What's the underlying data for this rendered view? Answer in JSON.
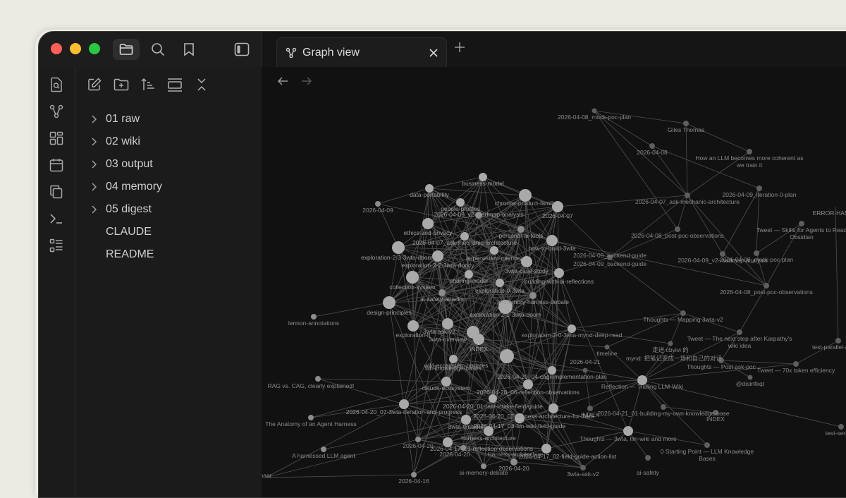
{
  "window": {
    "tabs": [
      {
        "label": "Graph view",
        "icon": "graph-icon"
      }
    ]
  },
  "titlebar": {
    "buttons": [
      "folder-icon",
      "search-icon",
      "bookmark-icon",
      "sidebar-toggle-icon"
    ]
  },
  "ribbon": {
    "icons": [
      "search-file-icon",
      "graph-icon",
      "dashboard-icon",
      "calendar-icon",
      "copy-icon",
      "terminal-icon",
      "list-icon"
    ]
  },
  "sidebar": {
    "tools": [
      "new-note-icon",
      "new-folder-icon",
      "sort-icon",
      "collapse-view-icon",
      "collapse-all-icon"
    ],
    "items": [
      {
        "label": "01 raw",
        "type": "folder"
      },
      {
        "label": "02 wiki",
        "type": "folder"
      },
      {
        "label": "03 output",
        "type": "folder"
      },
      {
        "label": "04 memory",
        "type": "folder"
      },
      {
        "label": "05 digest",
        "type": "folder"
      },
      {
        "label": "CLAUDE",
        "type": "file"
      },
      {
        "label": "README",
        "type": "file"
      }
    ]
  },
  "graph": {
    "nodes": [
      {
        "id": "n1",
        "label": "2026-04-08_mock-poc-plan"
      },
      {
        "id": "n2",
        "label": "Giles Thomas"
      },
      {
        "id": "n3",
        "label": "2026-04-08"
      },
      {
        "id": "n4",
        "label": "How an LLM becomes more coherent as"
      },
      {
        "id": "n4b",
        "label": "we train it"
      },
      {
        "id": "n5",
        "label": "2026-04-09_iteration-0-plan"
      },
      {
        "id": "n6",
        "label": "2026-04-07_ask-mechanic-architecture"
      },
      {
        "id": "n7",
        "label": "ERROR-HANDLI"
      },
      {
        "id": "n8",
        "label": "Tweet — Skills for Agents to Read"
      },
      {
        "id": "n8b",
        "label": "Obsidian"
      },
      {
        "id": "n9",
        "label": "2026-04-08_post-poc-observations"
      },
      {
        "id": "n10",
        "label": "2026-04-09_v2-roadmap-analysis"
      },
      {
        "id": "n11",
        "label": "2026-04-08_mock-poc-plan"
      },
      {
        "id": "n12",
        "label": "2026-04-09_backend-guide"
      },
      {
        "id": "n13",
        "label": "2026-04-08_post-poc-observations"
      },
      {
        "id": "n14",
        "label": "Thoughts — Mapping 3wta-v2"
      },
      {
        "id": "n15",
        "label": "Tweet — The next step after Karpathy's"
      },
      {
        "id": "n15b",
        "label": "wiki idea"
      },
      {
        "id": "n16",
        "label": "test-parallel-array.js"
      },
      {
        "id": "n17",
        "label": "走进 cbvivi 的"
      },
      {
        "id": "n18",
        "label": "mynd:  把笔记变成一场和自己的对话"
      },
      {
        "id": "n19",
        "label": "Thoughts — Post ask-poc"
      },
      {
        "id": "n20",
        "label": "Tweet — 70x token efficiency"
      },
      {
        "id": "n21",
        "label": "@disinfeqt"
      },
      {
        "id": "n22",
        "label": "timeline"
      },
      {
        "id": "n23",
        "label": "Reflection — Trialing LLM-Wiki"
      },
      {
        "id": "n24",
        "label": "2026-04-21_01-building-my-own-knowledge-base"
      },
      {
        "id": "n25",
        "label": "INDEX"
      },
      {
        "id": "n26",
        "label": "test-serial-o"
      },
      {
        "id": "n27",
        "label": "0 Starting Point — LLM Knowledge"
      },
      {
        "id": "n27b",
        "label": "Bases"
      },
      {
        "id": "n28",
        "label": "2026-04-21"
      },
      {
        "id": "n29",
        "label": "INDEX"
      },
      {
        "id": "n30",
        "label": "business-model"
      },
      {
        "id": "n31",
        "label": "data-portability"
      },
      {
        "id": "n32",
        "label": "people-profiles"
      },
      {
        "id": "n33",
        "label": "chronos-product-family"
      },
      {
        "id": "n34",
        "label": "2026-04-07"
      },
      {
        "id": "n35",
        "label": "2026-04-09"
      },
      {
        "id": "n36",
        "label": "2026-04-09_v2-roadmap-analysis"
      },
      {
        "id": "n37",
        "label": "ethics-and-privacy"
      },
      {
        "id": "n38",
        "label": "personal-ai-tools"
      },
      {
        "id": "n39",
        "label": "2026-04-07_ask-mechanic-architecture"
      },
      {
        "id": "n40",
        "label": "how-to-build-3wta"
      },
      {
        "id": "n41",
        "label": "2026-04-09_backend-guide"
      },
      {
        "id": "n42",
        "label": "exploration-2-3-3wta-dooms"
      },
      {
        "id": "n43",
        "label": "ai-persistent-memory"
      },
      {
        "id": "n44",
        "label": "exploration-2-2-3wta-doocy"
      },
      {
        "id": "n45",
        "label": "3wta-case-study"
      },
      {
        "id": "n46",
        "label": "sharing-model"
      },
      {
        "id": "n47",
        "label": "building-with-ai-reflections"
      },
      {
        "id": "n48",
        "label": "collection-system"
      },
      {
        "id": "n49",
        "label": "exploration-0-3wta"
      },
      {
        "id": "n50",
        "label": "ai-safety-attacks"
      },
      {
        "id": "n51",
        "label": "ai-memory-harness-debate"
      },
      {
        "id": "n52",
        "label": "design-principles"
      },
      {
        "id": "n53",
        "label": "exploration-2-1-3wta-doom"
      },
      {
        "id": "n54",
        "label": "lennon-annotations"
      },
      {
        "id": "n55",
        "label": "3wta-ask-v2"
      },
      {
        "id": "n56",
        "label": "3wta-overview"
      },
      {
        "id": "n57",
        "label": "exploration-h"
      },
      {
        "id": "n58",
        "label": "exploration-2-0-3wta-mynd-deep-read"
      },
      {
        "id": "n59",
        "label": "INDEX"
      },
      {
        "id": "n60",
        "label": "wiki-ecosystem-updates"
      },
      {
        "id": "n61",
        "label": "llm-knowledge-bases"
      },
      {
        "id": "n62",
        "label": "RAG vs. CAG, clearly explained!"
      },
      {
        "id": "n63",
        "label": "2026-04-20_04-cagi-implementation-plan"
      },
      {
        "id": "n64",
        "label": "claude-ecosystem"
      },
      {
        "id": "n65",
        "label": "2026-04-20_06-reflection-observations"
      },
      {
        "id": "n66",
        "label": "2026-04-20_07-3wta-iteration-and-progress"
      },
      {
        "id": "n67",
        "label": "2026-04-20_01-raw-intake-field-guide"
      },
      {
        "id": "n68",
        "label": "2026-04-20_03-harness-architecture-for-3wta"
      },
      {
        "id": "n69",
        "label": "3wta-timeline"
      },
      {
        "id": "n70",
        "label": "2026-04-17_03-llm-wiki-field-guide"
      },
      {
        "id": "n71",
        "label": "harness-architecture"
      },
      {
        "id": "n72",
        "label": "The Anatomy of an Agent Harness"
      },
      {
        "id": "n73",
        "label": "2026-04-17_01-reflection-observations"
      },
      {
        "id": "n74",
        "label": "Thoughts — 3wta, llm-wiki and more"
      },
      {
        "id": "n75",
        "label": "2026-04-20"
      },
      {
        "id": "n76",
        "label": "2026-04-20"
      },
      {
        "id": "n77",
        "label": "2026-04-17_02-field-guide-action-list"
      },
      {
        "id": "n78",
        "label": "A harnessed LLM agent"
      },
      {
        "id": "n79",
        "label": "2026-04-20"
      },
      {
        "id": "n80",
        "label": "ai-safety"
      },
      {
        "id": "n81",
        "label": "ai-memory-debate"
      },
      {
        "id": "n82",
        "label": "2026-04-16"
      },
      {
        "id": "n83",
        "label": "3wta-ask-v2"
      },
      {
        "id": "n84",
        "label": "Harness-architecture"
      },
      {
        "id": "n85",
        "label": "naar"
      }
    ]
  }
}
